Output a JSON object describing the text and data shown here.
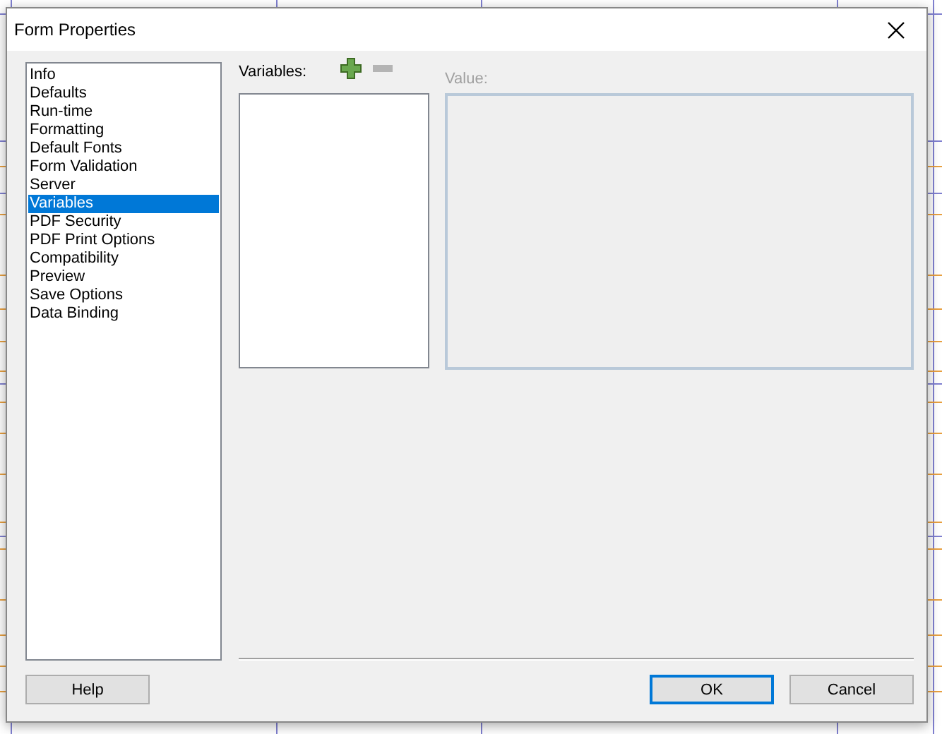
{
  "dialog": {
    "title": "Form Properties",
    "categories": [
      {
        "label": "Info",
        "selected": false
      },
      {
        "label": "Defaults",
        "selected": false
      },
      {
        "label": "Run-time",
        "selected": false
      },
      {
        "label": "Formatting",
        "selected": false
      },
      {
        "label": "Default Fonts",
        "selected": false
      },
      {
        "label": "Form Validation",
        "selected": false
      },
      {
        "label": "Server",
        "selected": false
      },
      {
        "label": "Variables",
        "selected": true
      },
      {
        "label": "PDF Security",
        "selected": false
      },
      {
        "label": "PDF Print Options",
        "selected": false
      },
      {
        "label": "Compatibility",
        "selected": false
      },
      {
        "label": "Preview",
        "selected": false
      },
      {
        "label": "Save Options",
        "selected": false
      },
      {
        "label": "Data Binding",
        "selected": false
      }
    ],
    "variables_label": "Variables:",
    "remove_disabled": true,
    "value_label": "Value:",
    "value_disabled": true,
    "help_button": {
      "label": "Help"
    },
    "buttons": [
      {
        "label": "OK",
        "default": true
      },
      {
        "label": "Cancel",
        "default": false
      }
    ]
  }
}
